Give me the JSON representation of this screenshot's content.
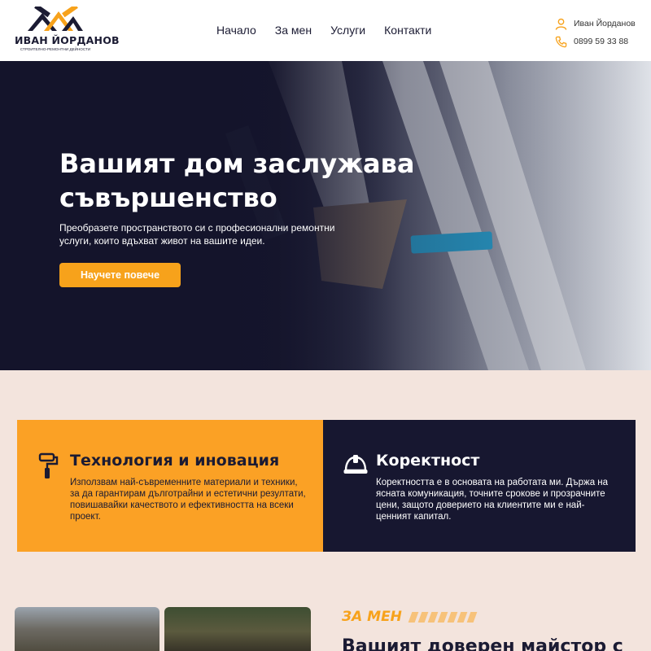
{
  "header": {
    "logo_name": "ИВАН ЙОРДАНОВ",
    "logo_tagline": "СТРОИТЕЛНО-РЕМОНТНИ ДЕЙНОСТИ",
    "nav": [
      "Начало",
      "За мен",
      "Услуги",
      "Контакти"
    ],
    "contact_name": "Иван Йорданов",
    "contact_phone": "0899 59 33 88"
  },
  "hero": {
    "title": "Вашият дом заслужава съвършенство",
    "subtitle": "Преобразете пространството си с професионални ремонтни услуги, които вдъхват живот на вашите идеи.",
    "button": "Научете повече"
  },
  "features": [
    {
      "icon": "paint-roller-icon",
      "title": "Технология и иновация",
      "text": "Използвам най-съвременните материали и техники, за да гарантирам дълготрайни и естетични резултати, повишавайки качеството и ефективността на всеки проект."
    },
    {
      "icon": "hard-hat-icon",
      "title": "Коректност",
      "text": "Коректността е в основата на работата ми. Държа на ясната комуникация, точните срокове и прозрачните цени, защото доверието на клиентите ми е най-ценният капитал."
    }
  ],
  "about": {
    "label": "ЗА МЕН",
    "title": "Вашият доверен майстор с"
  },
  "colors": {
    "accent": "#f7a21b",
    "dark": "#171730",
    "background": "#f3e4dd"
  }
}
